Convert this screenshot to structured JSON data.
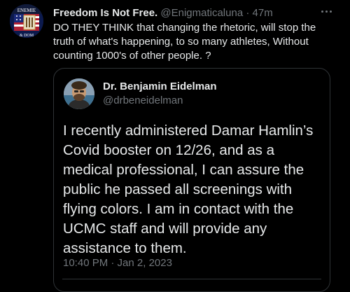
{
  "colors": {
    "background": "#000000",
    "primary_text": "#e7e9ea",
    "secondary_text": "#71767b",
    "border": "#2f3336"
  },
  "tweet": {
    "display_name": "Freedom Is Not Free.",
    "handle": "@Enigmaticaluna",
    "separator": "·",
    "time": "47m",
    "text": "DO THEY THINK that changing the rhetoric, will stop the truth of what's happening, to so many athletes, Without counting 1000's of other people. ?",
    "avatar_icon": "patriotic-logo-avatar",
    "more_icon": "more-options-icon"
  },
  "quoted_tweet": {
    "display_name": "Dr. Benjamin Eidelman",
    "handle": "@drbeneidelman",
    "text": "I recently administered Damar Hamlin’s Covid booster on 12/26, and as a medical professional, I can assure the public he passed all screenings with flying colors. I am in contact with the UCMC staff and will provide any assistance to them.",
    "timestamp": "10:40 PM · Jan 2, 2023",
    "avatar_icon": "portrait-avatar"
  }
}
